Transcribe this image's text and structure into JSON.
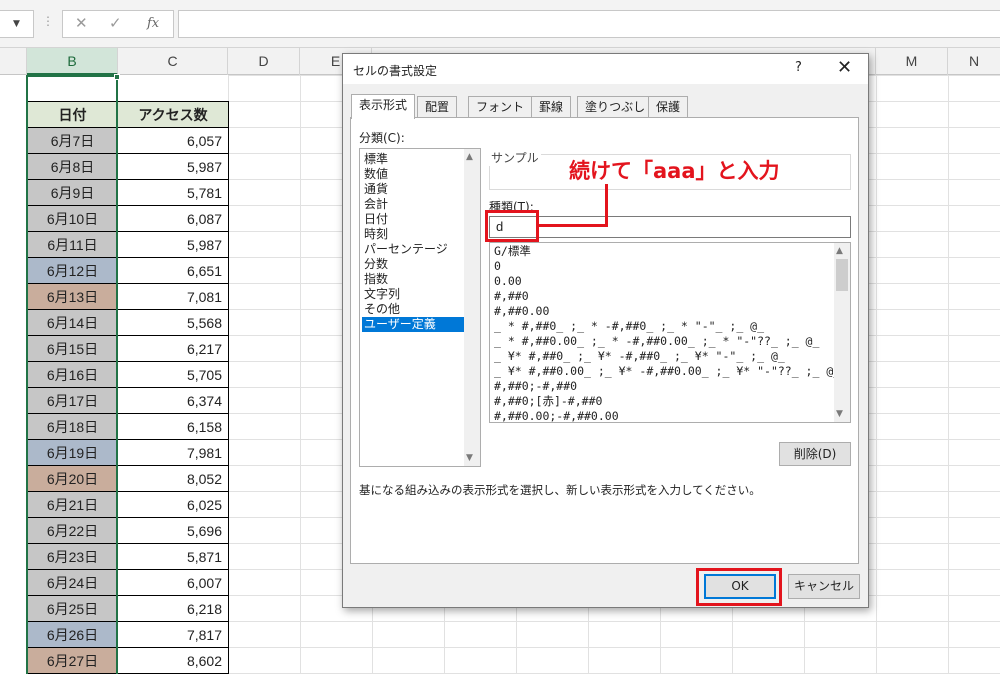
{
  "formula_bar": {
    "name_dropdown": "▼",
    "separator": "⋮",
    "cancel_icon": "✕",
    "enter_icon": "✓",
    "fx_label": "fx",
    "formula_value": ""
  },
  "columns": {
    "b": "B",
    "c": "C",
    "d": "D",
    "e": "E",
    "m": "M",
    "n": "N"
  },
  "table": {
    "header_date": "日付",
    "header_access": "アクセス数",
    "rows": [
      {
        "date": "6月7日",
        "value": "6,057"
      },
      {
        "date": "6月8日",
        "value": "5,987"
      },
      {
        "date": "6月9日",
        "value": "5,781"
      },
      {
        "date": "6月10日",
        "value": "6,087"
      },
      {
        "date": "6月11日",
        "value": "5,987"
      },
      {
        "date": "6月12日",
        "value": "6,651"
      },
      {
        "date": "6月13日",
        "value": "7,081"
      },
      {
        "date": "6月14日",
        "value": "5,568"
      },
      {
        "date": "6月15日",
        "value": "6,217"
      },
      {
        "date": "6月16日",
        "value": "5,705"
      },
      {
        "date": "6月17日",
        "value": "6,374"
      },
      {
        "date": "6月18日",
        "value": "6,158"
      },
      {
        "date": "6月19日",
        "value": "7,981"
      },
      {
        "date": "6月20日",
        "value": "8,052"
      },
      {
        "date": "6月21日",
        "value": "6,025"
      },
      {
        "date": "6月22日",
        "value": "5,696"
      },
      {
        "date": "6月23日",
        "value": "5,871"
      },
      {
        "date": "6月24日",
        "value": "6,007"
      },
      {
        "date": "6月25日",
        "value": "6,218"
      },
      {
        "date": "6月26日",
        "value": "7,817"
      },
      {
        "date": "6月27日",
        "value": "8,602"
      }
    ],
    "row_colors": {
      "weekday": "#c6c6c6",
      "saturday": "#acb9ca",
      "sunday": "#c9ad9c"
    }
  },
  "dialog": {
    "title": "セルの書式設定",
    "help": "?",
    "close": "✕",
    "tabs": [
      "表示形式",
      "配置",
      "フォント",
      "罫線",
      "塗りつぶし",
      "保護"
    ],
    "category_label": "分類(C):",
    "categories": [
      "標準",
      "数値",
      "通貨",
      "会計",
      "日付",
      "時刻",
      "パーセンテージ",
      "分数",
      "指数",
      "文字列",
      "その他",
      "ユーザー定義"
    ],
    "sample_label": "サンプル",
    "sample_value": "",
    "type_label": "種類(T):",
    "type_value": "d",
    "formats": [
      "G/標準",
      "0",
      "0.00",
      "#,##0",
      "#,##0.00",
      "_ * #,##0_ ;_ * -#,##0_ ;_ * \"-\"_ ;_ @_",
      "_ * #,##0.00_ ;_ * -#,##0.00_ ;_ * \"-\"??_ ;_ @_",
      "_ ¥* #,##0_ ;_ ¥* -#,##0_ ;_ ¥* \"-\"_ ;_ @_",
      "_ ¥* #,##0.00_ ;_ ¥* -#,##0.00_ ;_ ¥* \"-\"??_ ;_ @_",
      "#,##0;-#,##0",
      "#,##0;[赤]-#,##0",
      "#,##0.00;-#,##0.00"
    ],
    "delete_label": "削除(D)",
    "description": "基になる組み込みの表示形式を選択し、新しい表示形式を入力してください。",
    "ok_label": "OK",
    "cancel_label": "キャンセル"
  },
  "annotation": {
    "callout": "続けて「aaa」と入力",
    "color": "#e3141d"
  }
}
